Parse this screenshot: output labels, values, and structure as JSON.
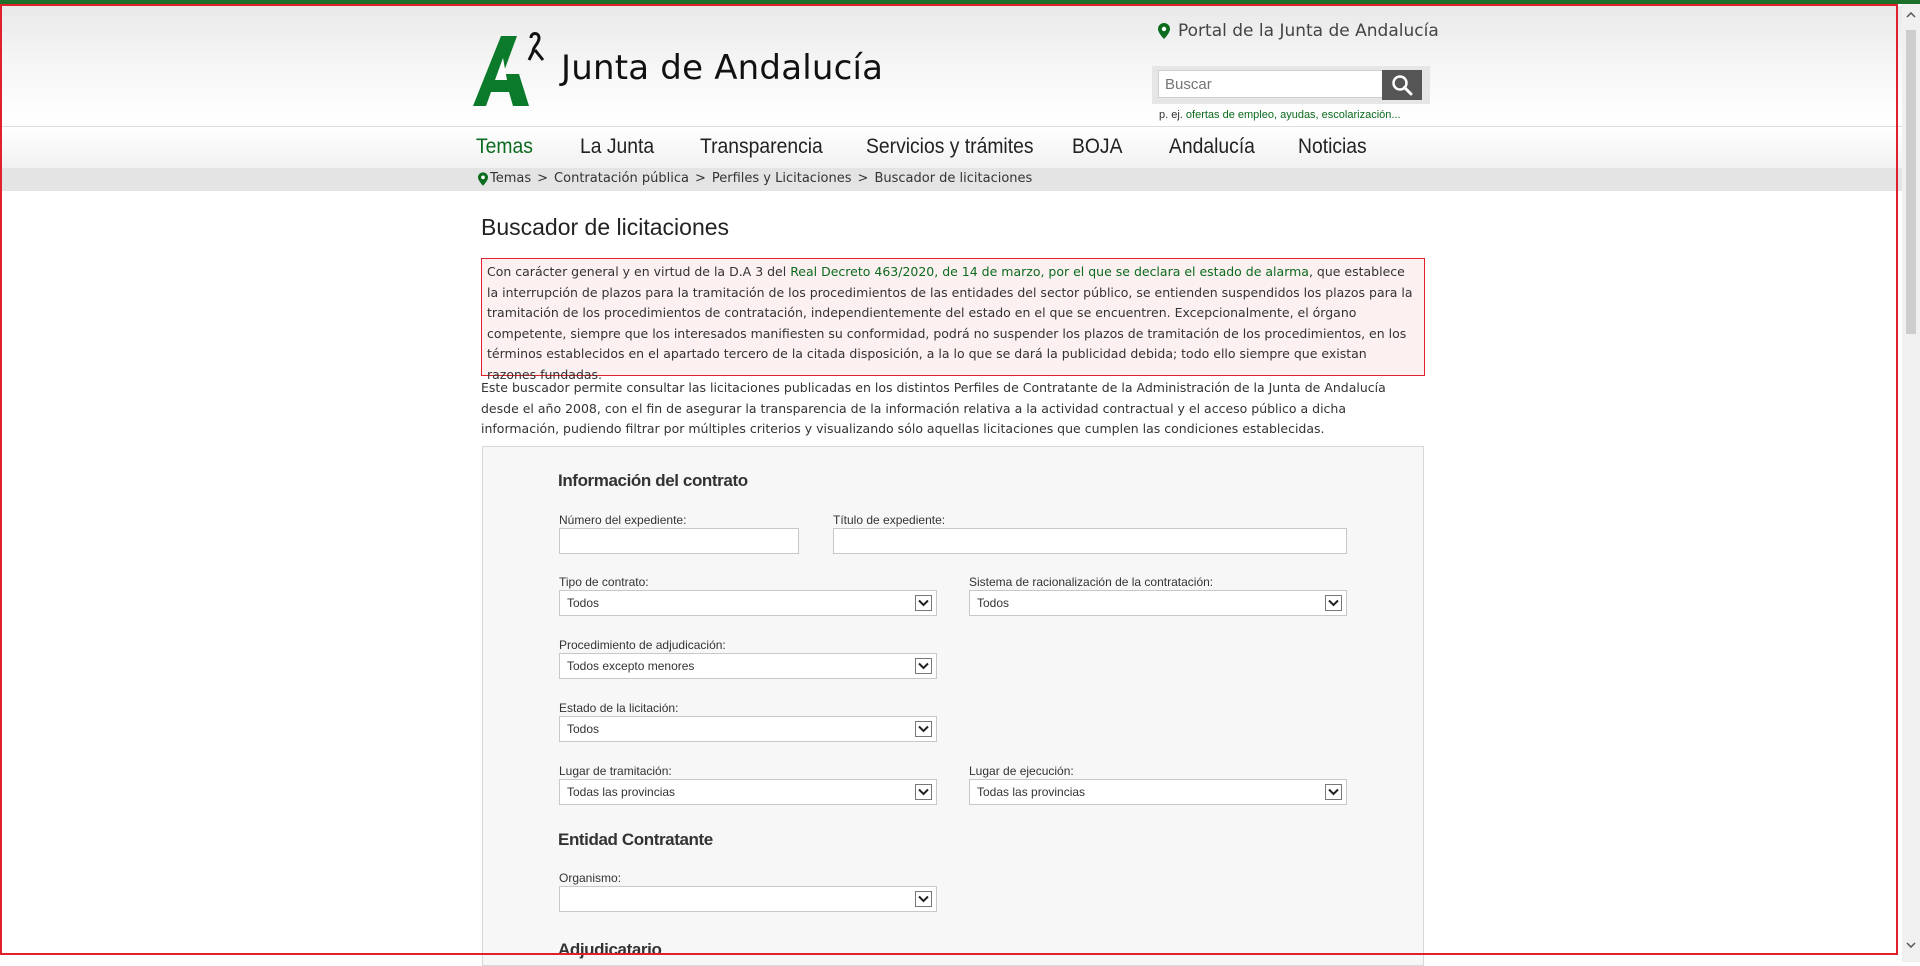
{
  "header": {
    "logo_text": "Junta de Andalucía",
    "portal_link": "Portal de la Junta de Andalucía",
    "search": {
      "placeholder": "Buscar",
      "hint_prefix": "p. ej.",
      "hint_links": "ofertas de empleo, ayudas, escolarización..."
    }
  },
  "nav": {
    "items": [
      {
        "label": "Temas"
      },
      {
        "label": "La Junta"
      },
      {
        "label": "Transparencia"
      },
      {
        "label": "Servicios y trámites"
      },
      {
        "label": "BOJA"
      },
      {
        "label": "Andalucía"
      },
      {
        "label": "Noticias"
      }
    ]
  },
  "breadcrumb": {
    "items": [
      "Temas",
      "Contratación pública",
      "Perfiles y Licitaciones",
      "Buscador de licitaciones"
    ],
    "separator": ">"
  },
  "main": {
    "title": "Buscador de licitaciones",
    "alert": {
      "before_link": "Con carácter general y en virtud de la D.A 3 del ",
      "link": "Real Decreto 463/2020, de 14 de marzo, por el que se declara el estado de alarma",
      "after_link": ", que establece la interrupción de plazos para la tramitación de los procedimientos de las entidades del sector público, se entienden suspendidos los plazos para la tramitación de los procedimientos de contratación, independientemente del estado en el que se encuentren. Excepcionalmente, el órgano competente, siempre que los interesados manifiesten su conformidad, podrá no suspender los plazos de tramitación de los procedimientos, en los términos establecidos en el apartado tercero de la citada disposición, a la lo que se dará la publicidad debida; todo ello siempre que existan razones fundadas."
    },
    "intro": "Este buscador permite consultar las licitaciones publicadas en los distintos Perfiles de Contratante de la Administración de la Junta de Andalucía desde el año 2008, con el fin de asegurar la transparencia de la información relativa a la actividad contractual y el acceso público a dicha información, pudiendo filtrar por múltiples criterios y visualizando sólo aquellas licitaciones que cumplen las condiciones establecidas."
  },
  "form": {
    "contract_info_title": "Información del contrato",
    "expediente_number": {
      "label": "Número del expediente:",
      "value": ""
    },
    "expediente_title": {
      "label": "Título de expediente:",
      "value": ""
    },
    "contract_type": {
      "label": "Tipo de contrato:",
      "value": "Todos"
    },
    "rationalization_system": {
      "label": "Sistema de racionalización de la contratación:",
      "value": "Todos"
    },
    "award_procedure": {
      "label": "Procedimiento de adjudicación:",
      "value": "Todos excepto menores"
    },
    "tender_status": {
      "label": "Estado de la licitación:",
      "value": "Todos"
    },
    "processing_place": {
      "label": "Lugar de tramitación:",
      "value": "Todas las provincias"
    },
    "execution_place": {
      "label": "Lugar de ejecución:",
      "value": "Todas las provincias"
    },
    "contracting_entity_title": "Entidad Contratante",
    "organism": {
      "label": "Organismo:",
      "value": ""
    },
    "awardee_title": "Adjudicatario"
  },
  "colors": {
    "brand_green": "#0b6b1e",
    "alert_border": "#e0202a",
    "alert_bg": "#fdf0f0"
  }
}
